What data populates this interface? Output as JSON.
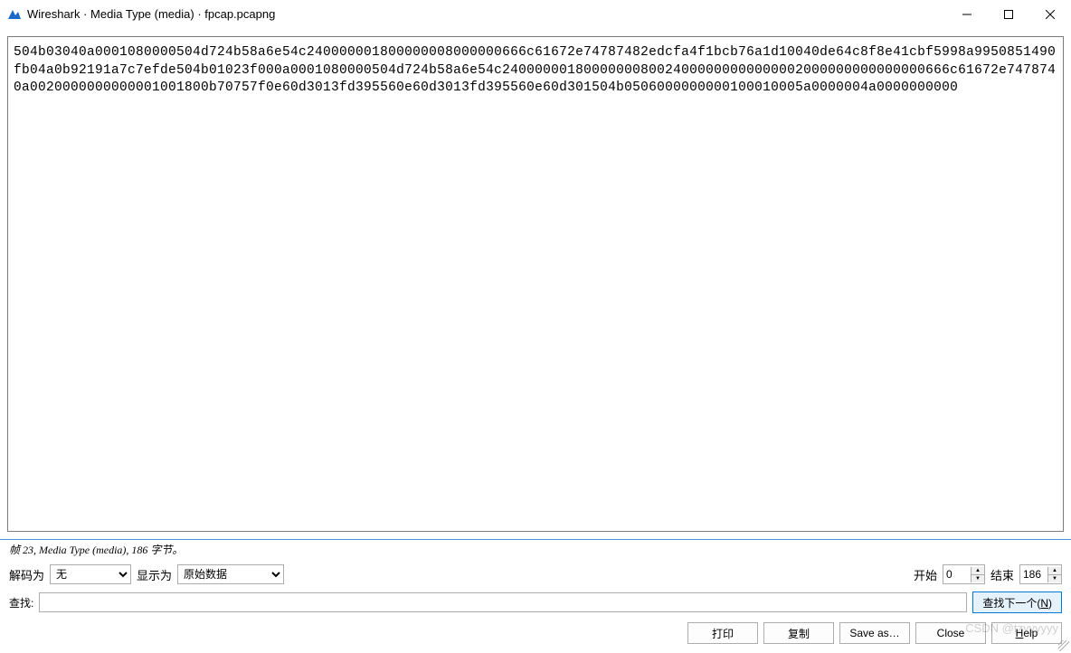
{
  "window": {
    "title": "Wireshark · Media Type (media) · fpcap.pcapng"
  },
  "content": {
    "hex": "504b03040a0001080000504d724b58a6e54c240000001800000008000000666c61672e74787482edcfa4f1bcb76a1d10040de64c8f8e41cbf5998a9950851490fb04a0b92191a7c7efde504b01023f000a0001080000504d724b58a6e54c2400000018000000080024000000000000002000000000000000666c61672e7478740a0020000000000001001800b70757f0e60d3013fd395560e60d3013fd395560e60d301504b0506000000000100010005a0000004a0000000000"
  },
  "status": {
    "text": "帧 23, Media Type (media), 186 字节。"
  },
  "controls": {
    "decode_label": "解码为",
    "decode_value": "无",
    "display_label": "显示为",
    "display_value": "原始数据",
    "start_label": "开始",
    "start_value": "0",
    "end_label": "结束",
    "end_value": "186"
  },
  "find": {
    "label": "查找:",
    "value": "",
    "next_label": "查找下一个(N)"
  },
  "buttons": {
    "print": "打印",
    "copy": "复制",
    "save_as": "Save as…",
    "close": "Close",
    "help": "Help"
  },
  "watermark": "CSDN @tzyyyyyy"
}
